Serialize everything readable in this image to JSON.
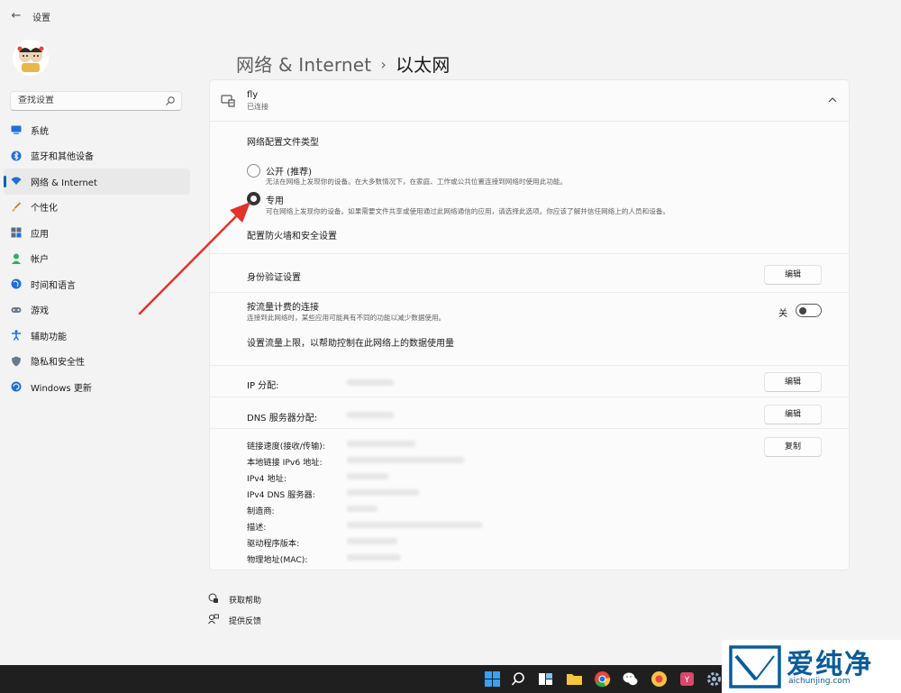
{
  "window": {
    "title": "设置",
    "back_symbol": "←"
  },
  "search": {
    "placeholder": "查找设置"
  },
  "sidebar": {
    "items": [
      {
        "label": "系统",
        "icon": "monitor-icon"
      },
      {
        "label": "蓝牙和其他设备",
        "icon": "bluetooth-icon"
      },
      {
        "label": "网络 & Internet",
        "icon": "wifi-icon",
        "active": true
      },
      {
        "label": "个性化",
        "icon": "brush-icon"
      },
      {
        "label": "应用",
        "icon": "apps-icon"
      },
      {
        "label": "帐户",
        "icon": "person-icon"
      },
      {
        "label": "时间和语言",
        "icon": "globe-icon"
      },
      {
        "label": "游戏",
        "icon": "gamepad-icon"
      },
      {
        "label": "辅助功能",
        "icon": "accessibility-icon"
      },
      {
        "label": "隐私和安全性",
        "icon": "shield-icon"
      },
      {
        "label": "Windows 更新",
        "icon": "update-icon"
      }
    ]
  },
  "breadcrumb": {
    "parent": "网络 & Internet",
    "separator": "›",
    "current": "以太网"
  },
  "connection": {
    "name": "fly",
    "status": "已连接"
  },
  "profile": {
    "heading": "网络配置文件类型",
    "public_label": "公开 (推荐)",
    "public_desc": "无法在网络上发现你的设备。在大多数情况下，在家庭、工作或公共位置连接到网络时使用此功能。",
    "private_label": "专用",
    "private_desc": "可在网络上发现你的设备。如果需要文件共享或使用通过此网络通信的应用，请选择此选项。你应该了解并信任网络上的人员和设备。",
    "selected": "private",
    "firewall_link": "配置防火墙和安全设置"
  },
  "auth": {
    "label": "身份验证设置",
    "button": "编辑"
  },
  "metered": {
    "label": "按流量计费的连接",
    "desc": "连接到此网络时，某些应用可能具有不同的功能以减少数据使用。",
    "toggle_label": "关",
    "toggle_on": false,
    "data_limit_link": "设置流量上限，以帮助控制在此网络上的数据使用量"
  },
  "ip": {
    "label": "IP 分配:",
    "button": "编辑"
  },
  "dns": {
    "label": "DNS 服务器分配:",
    "button": "编辑"
  },
  "properties": {
    "labels": [
      "链接速度(接收/传输):",
      "本地链接 IPv6 地址:",
      "IPv4 地址:",
      "IPv4 DNS 服务器:",
      "制造商:",
      "描述:",
      "驱动程序版本:",
      "物理地址(MAC):"
    ],
    "copy_button": "复制"
  },
  "footer": {
    "get_help": "获取帮助",
    "feedback": "提供反馈"
  },
  "watermark": {
    "brand": "爱纯净",
    "url": "aichunjing.com"
  },
  "colors": {
    "accent": "#005fb8",
    "arrow": "#e0332c",
    "taskbar": "#1f1f1f"
  }
}
